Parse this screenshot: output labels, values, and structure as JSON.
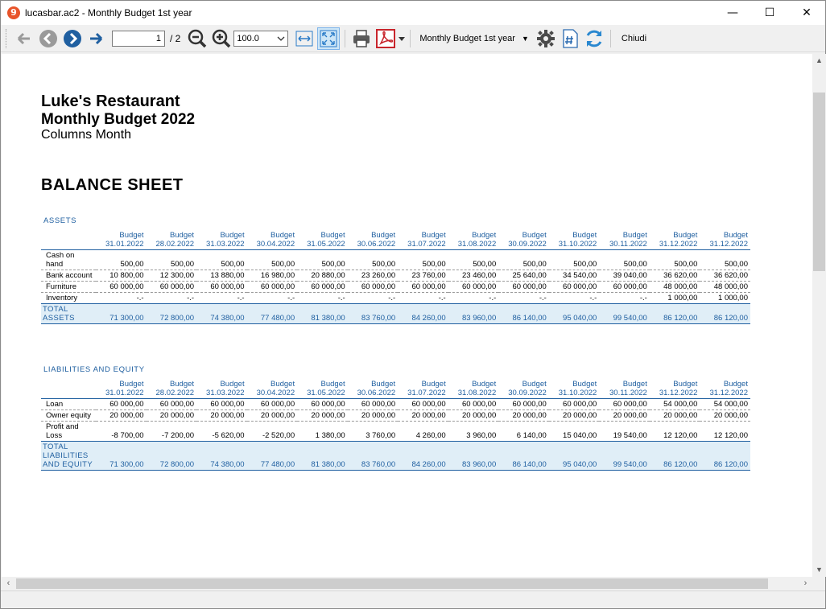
{
  "window": {
    "title": "lucasbar.ac2 - Monthly Budget 1st year",
    "controls": {
      "minimize": "—",
      "maximize": "☐",
      "close": "✕"
    }
  },
  "toolbar": {
    "page_current": "1",
    "page_total": "/ 2",
    "zoom_value": "100.0",
    "report_selector": "Monthly Budget 1st year",
    "close_label": "Chiudi",
    "accent_color": "#1f5fa0"
  },
  "report": {
    "title": "Luke's Restaurant",
    "subtitle": "Monthly Budget 2022",
    "columns_label": "Columns Month",
    "section": "BALANCE SHEET",
    "columns": [
      {
        "l1": "Budget",
        "l2": "31.01.2022"
      },
      {
        "l1": "Budget",
        "l2": "28.02.2022"
      },
      {
        "l1": "Budget",
        "l2": "31.03.2022"
      },
      {
        "l1": "Budget",
        "l2": "30.04.2022"
      },
      {
        "l1": "Budget",
        "l2": "31.05.2022"
      },
      {
        "l1": "Budget",
        "l2": "30.06.2022"
      },
      {
        "l1": "Budget",
        "l2": "31.07.2022"
      },
      {
        "l1": "Budget",
        "l2": "31.08.2022"
      },
      {
        "l1": "Budget",
        "l2": "30.09.2022"
      },
      {
        "l1": "Budget",
        "l2": "31.10.2022"
      },
      {
        "l1": "Budget",
        "l2": "30.11.2022"
      },
      {
        "l1": "Budget",
        "l2": "31.12.2022"
      },
      {
        "l1": "Budget",
        "l2": "31.12.2022"
      }
    ],
    "assets": {
      "title": "ASSETS",
      "rows": [
        {
          "label": "Cash on hand",
          "values": [
            "500,00",
            "500,00",
            "500,00",
            "500,00",
            "500,00",
            "500,00",
            "500,00",
            "500,00",
            "500,00",
            "500,00",
            "500,00",
            "500,00",
            "500,00"
          ]
        },
        {
          "label": "Bank account",
          "values": [
            "10 800,00",
            "12 300,00",
            "13 880,00",
            "16 980,00",
            "20 880,00",
            "23 260,00",
            "23 760,00",
            "23 460,00",
            "25 640,00",
            "34 540,00",
            "39 040,00",
            "36 620,00",
            "36 620,00"
          ]
        },
        {
          "label": "Furniture",
          "values": [
            "60 000,00",
            "60 000,00",
            "60 000,00",
            "60 000,00",
            "60 000,00",
            "60 000,00",
            "60 000,00",
            "60 000,00",
            "60 000,00",
            "60 000,00",
            "60 000,00",
            "48 000,00",
            "48 000,00"
          ]
        },
        {
          "label": "Inventory",
          "values": [
            "-.-",
            "-.-",
            "-.-",
            "-.-",
            "-.-",
            "-.-",
            "-.-",
            "-.-",
            "-.-",
            "-.-",
            "-.-",
            "1 000,00",
            "1 000,00"
          ]
        }
      ],
      "total": {
        "label": "TOTAL ASSETS",
        "values": [
          "71 300,00",
          "72 800,00",
          "74 380,00",
          "77 480,00",
          "81 380,00",
          "83 760,00",
          "84 260,00",
          "83 960,00",
          "86 140,00",
          "95 040,00",
          "99 540,00",
          "86 120,00",
          "86 120,00"
        ]
      }
    },
    "liabilities": {
      "title": "LIABILITIES AND EQUITY",
      "rows": [
        {
          "label": "Loan",
          "values": [
            "60 000,00",
            "60 000,00",
            "60 000,00",
            "60 000,00",
            "60 000,00",
            "60 000,00",
            "60 000,00",
            "60 000,00",
            "60 000,00",
            "60 000,00",
            "60 000,00",
            "54 000,00",
            "54 000,00"
          ]
        },
        {
          "label": "Owner equity",
          "values": [
            "20 000,00",
            "20 000,00",
            "20 000,00",
            "20 000,00",
            "20 000,00",
            "20 000,00",
            "20 000,00",
            "20 000,00",
            "20 000,00",
            "20 000,00",
            "20 000,00",
            "20 000,00",
            "20 000,00"
          ]
        },
        {
          "label": "Profit and Loss",
          "values": [
            "-8 700,00",
            "-7 200,00",
            "-5 620,00",
            "-2 520,00",
            "1 380,00",
            "3 760,00",
            "4 260,00",
            "3 960,00",
            "6 140,00",
            "15 040,00",
            "19 540,00",
            "12 120,00",
            "12 120,00"
          ]
        }
      ],
      "total": {
        "label": "TOTAL LIABILITIES AND EQUITY",
        "values": [
          "71 300,00",
          "72 800,00",
          "74 380,00",
          "77 480,00",
          "81 380,00",
          "83 760,00",
          "84 260,00",
          "83 960,00",
          "86 140,00",
          "95 040,00",
          "99 540,00",
          "86 120,00",
          "86 120,00"
        ]
      }
    }
  }
}
